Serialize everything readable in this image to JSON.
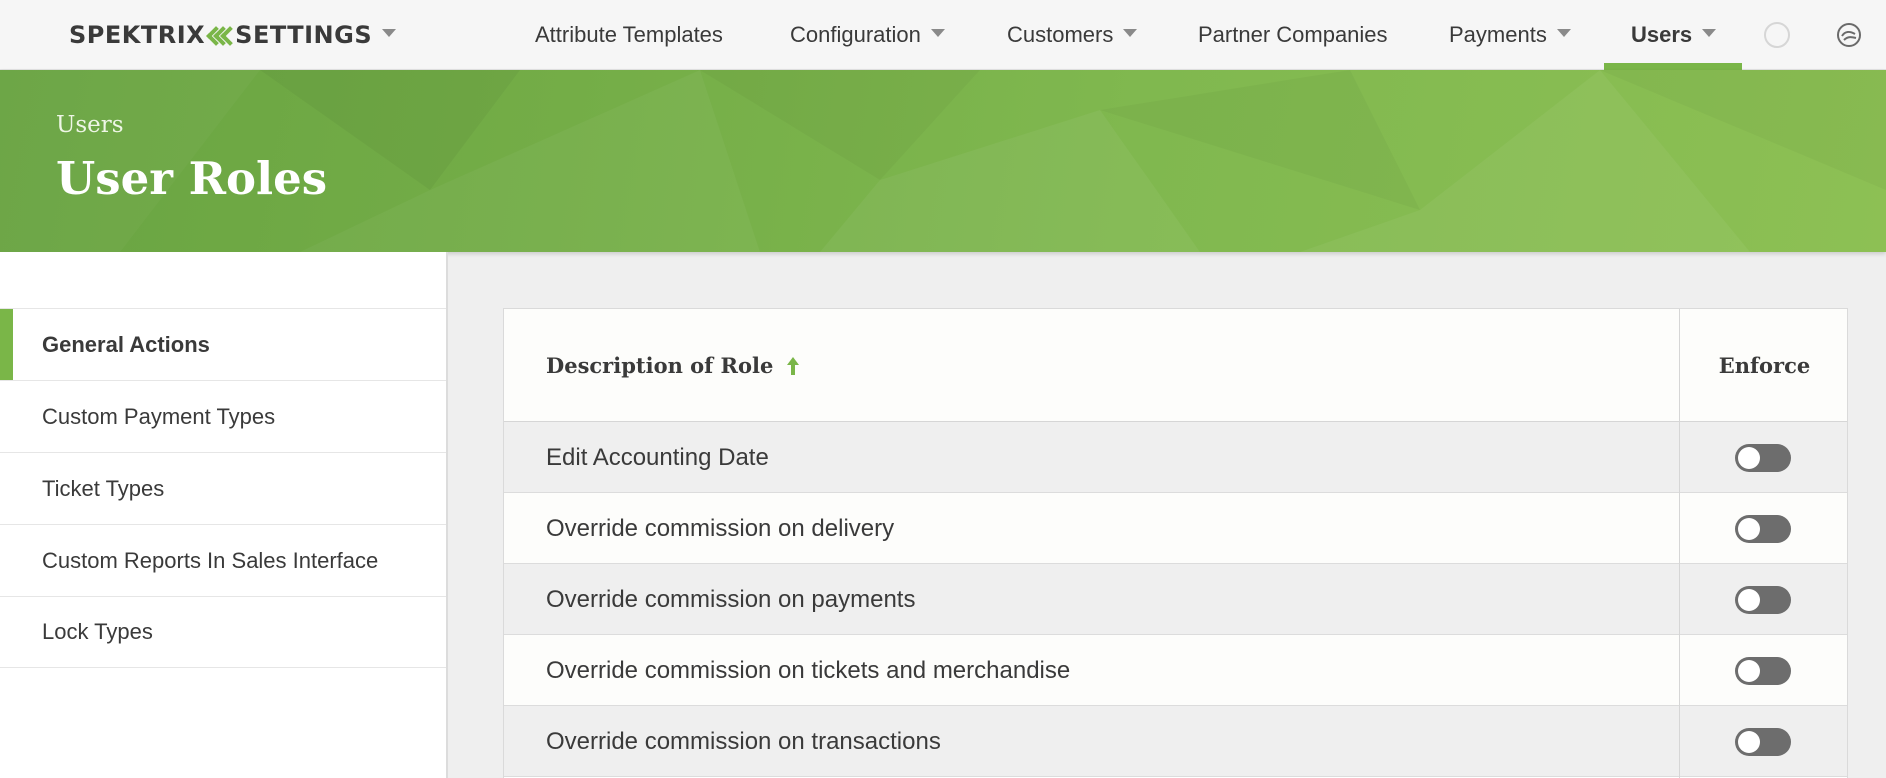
{
  "brand": {
    "name": "SPEKTRIX",
    "section": "SETTINGS",
    "accent_color": "#7ab648"
  },
  "nav": {
    "items": [
      {
        "label": "Attribute Templates",
        "has_dropdown": false
      },
      {
        "label": "Configuration",
        "has_dropdown": true
      },
      {
        "label": "Customers",
        "has_dropdown": true
      },
      {
        "label": "Partner Companies",
        "has_dropdown": false
      },
      {
        "label": "Payments",
        "has_dropdown": true
      },
      {
        "label": "Users",
        "has_dropdown": true,
        "active": true
      }
    ],
    "icons": [
      "status-circle-icon",
      "spektrix-swirl-icon"
    ]
  },
  "banner": {
    "breadcrumb": "Users",
    "title": "User Roles"
  },
  "sidebar": {
    "items": [
      {
        "label": "General Actions",
        "active": true
      },
      {
        "label": "Custom Payment Types"
      },
      {
        "label": "Ticket Types"
      },
      {
        "label": "Custom Reports In Sales Interface"
      },
      {
        "label": "Lock Types"
      }
    ]
  },
  "table": {
    "columns": {
      "description": "Description of Role",
      "enforce": "Enforce"
    },
    "sort": {
      "column": "description",
      "direction": "ascending",
      "icon": "sort-ascending-arrow-icon"
    },
    "rows": [
      {
        "description": "Edit Accounting Date",
        "enforce": false
      },
      {
        "description": "Override commission on delivery",
        "enforce": false
      },
      {
        "description": "Override commission on payments",
        "enforce": false
      },
      {
        "description": "Override commission on tickets and merchandise",
        "enforce": false
      },
      {
        "description": "Override commission on transactions",
        "enforce": false
      }
    ]
  }
}
